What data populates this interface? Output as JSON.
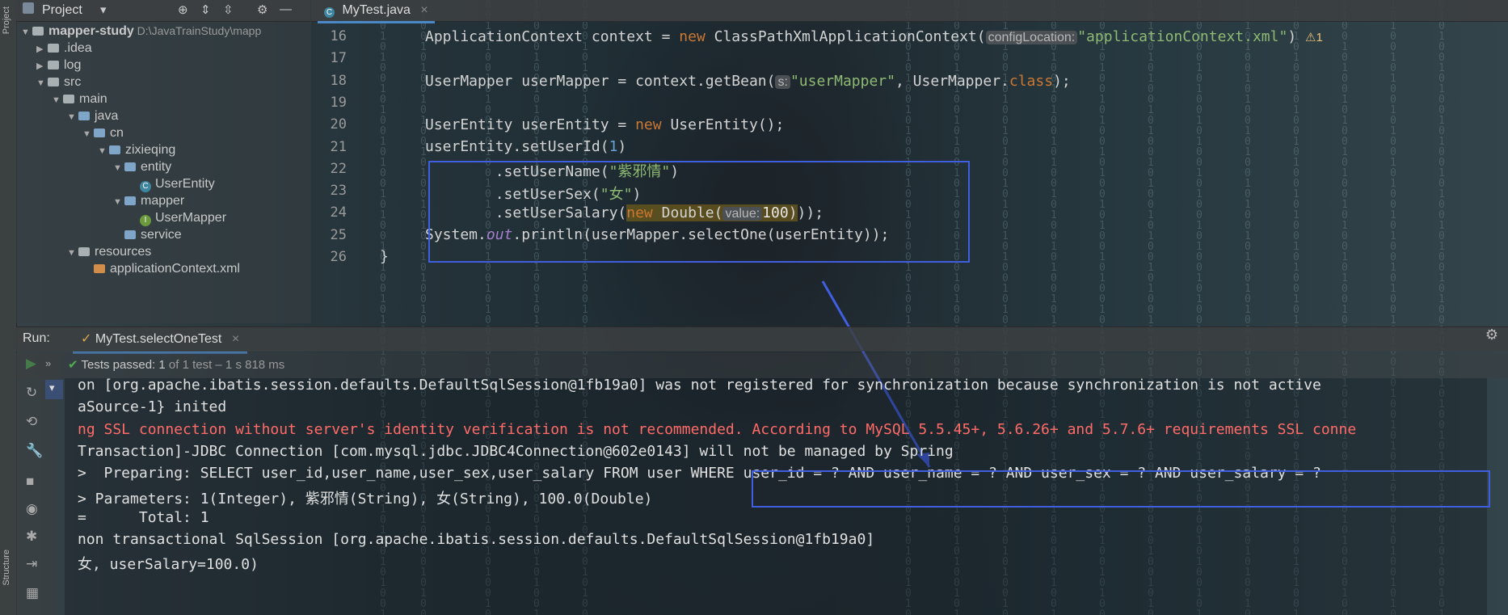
{
  "project_panel": {
    "title": "Project",
    "tree": [
      {
        "label": "mapper-study",
        "path": "D:\\JavaTrainStudy\\mapp",
        "kind": "module",
        "indent": 0,
        "expanded": true
      },
      {
        "label": ".idea",
        "kind": "folder",
        "indent": 1,
        "expanded": false
      },
      {
        "label": "log",
        "kind": "folder",
        "indent": 1,
        "expanded": false
      },
      {
        "label": "src",
        "kind": "folder",
        "indent": 1,
        "expanded": true
      },
      {
        "label": "main",
        "kind": "folder",
        "indent": 2,
        "expanded": true
      },
      {
        "label": "java",
        "kind": "source-folder",
        "indent": 3,
        "expanded": true
      },
      {
        "label": "cn",
        "kind": "package",
        "indent": 4,
        "expanded": true
      },
      {
        "label": "zixieqing",
        "kind": "package",
        "indent": 5,
        "expanded": true
      },
      {
        "label": "entity",
        "kind": "package",
        "indent": 6,
        "expanded": true
      },
      {
        "label": "UserEntity",
        "kind": "class",
        "indent": 7
      },
      {
        "label": "mapper",
        "kind": "package",
        "indent": 6,
        "expanded": true
      },
      {
        "label": "UserMapper",
        "kind": "interface",
        "indent": 7
      },
      {
        "label": "service",
        "kind": "package",
        "indent": 6
      },
      {
        "label": "resources",
        "kind": "folder",
        "indent": 3,
        "expanded": true
      },
      {
        "label": "applicationContext.xml",
        "kind": "xml",
        "indent": 4
      }
    ]
  },
  "side_labels": {
    "project": "Project",
    "structure": "Structure"
  },
  "editor": {
    "tab": "MyTest.java",
    "line_numbers": [
      "16",
      "17",
      "18",
      "19",
      "20",
      "21",
      "22",
      "23",
      "24",
      "25",
      "26"
    ],
    "warning_count": "1",
    "lines": {
      "l16_a": "ApplicationContext context = ",
      "l16_new": "new",
      "l16_b": " ClassPathXmlApplicationContext(",
      "l16_hint": "configLocation:",
      "l16_str": "\"applicationContext.xml\"",
      "l16_c": ")",
      "l18_a": "UserMapper userMapper = context.getBean(",
      "l18_hint": "s:",
      "l18_str": "\"userMapper\"",
      "l18_b": ", UserMapper.",
      "l18_kw": "class",
      "l18_c": ");",
      "l20_a": "UserEntity userEntity = ",
      "l20_new": "new",
      "l20_b": " UserEntity();",
      "l21_a": "userEntity.setUserId(",
      "l21_num": "1",
      "l21_b": ")",
      "l22_a": "        .setUserName(",
      "l22_str": "\"紫邪情\"",
      "l22_b": ")",
      "l23_a": "        .setUserSex(",
      "l23_str": "\"女\"",
      "l23_b": ")",
      "l24_a": "        .setUserSalary(",
      "l24_new": "new",
      "l24_b": " Double(",
      "l24_hint": "value:",
      "l24_num": "100",
      "l24_c": "));",
      "l25_a": "System.",
      "l25_out": "out",
      "l25_b": ".println(userMapper.selectOne(userEntity));",
      "l26": "}"
    }
  },
  "run_panel": {
    "label": "Run:",
    "tab": "MyTest.selectOneTest",
    "status": "Tests passed:",
    "status_count": "1",
    "status_detail": "of 1 test – 1 s 818 ms",
    "console": [
      {
        "text": "on [org.apache.ibatis.session.defaults.DefaultSqlSession@1fb19a0] was not registered for synchronization because synchronization is not active",
        "color": "normal"
      },
      {
        "text": "aSource-1} inited",
        "color": "normal"
      },
      {
        "text": "ng SSL connection without server's identity verification is not recommended. According to MySQL 5.5.45+, 5.6.26+ and 5.7.6+ requirements SSL conne",
        "color": "red"
      },
      {
        "text": "Transaction]-JDBC Connection [com.mysql.jdbc.JDBC4Connection@602e0143] will not be managed by Spring",
        "color": "normal"
      },
      {
        "text": ">  Preparing: SELECT user_id,user_name,user_sex,user_salary FROM user WHERE user_id = ? AND user_name = ? AND user_sex = ? AND user_salary = ?",
        "color": "normal"
      },
      {
        "text": "> Parameters: 1(Integer), 紫邪情(String), 女(String), 100.0(Double)",
        "color": "normal"
      },
      {
        "text": "=      Total: 1",
        "color": "normal"
      },
      {
        "text": "non transactional SqlSession [org.apache.ibatis.session.defaults.DefaultSqlSession@1fb19a0]",
        "color": "normal"
      },
      {
        "text": "女, userSalary=100.0)",
        "color": "normal"
      }
    ]
  },
  "colors": {
    "annotation": "#3f5fe0",
    "keyword": "#cc7832",
    "string": "#8fba73",
    "error": "#ff6b68"
  }
}
